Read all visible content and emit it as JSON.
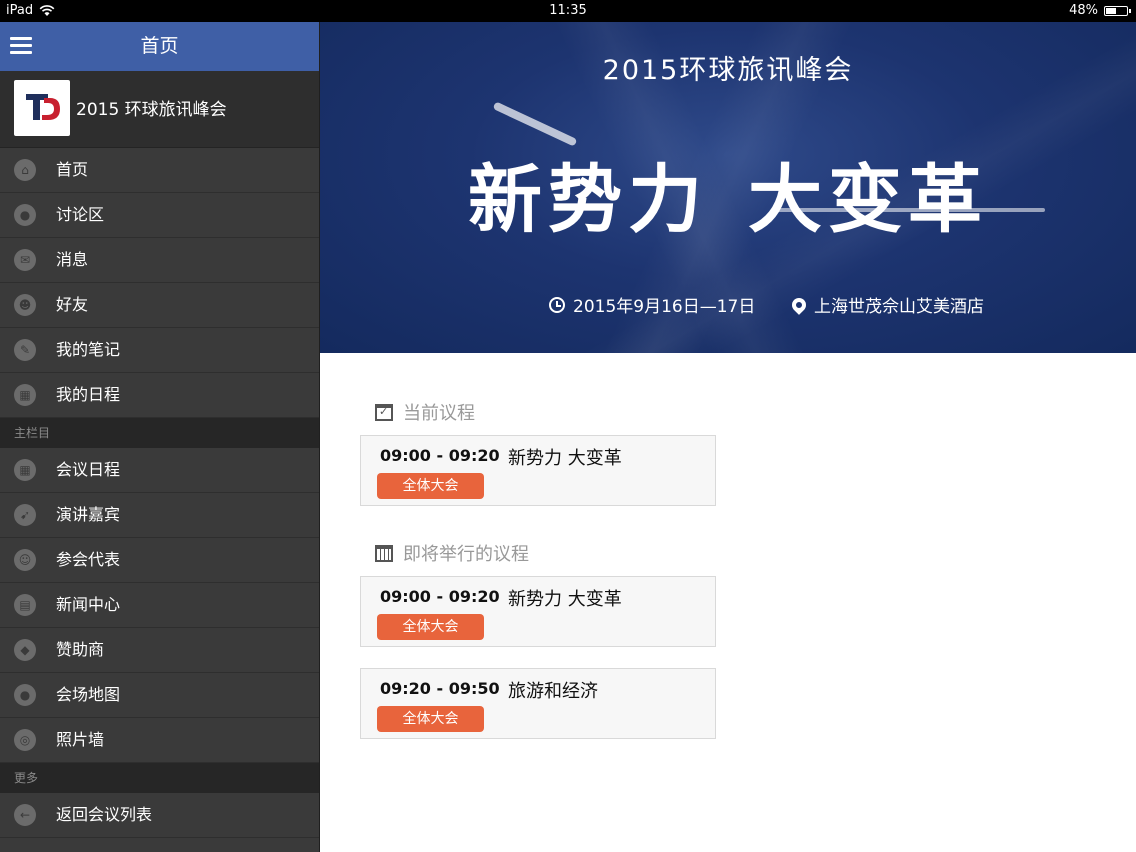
{
  "status_bar": {
    "device": "iPad",
    "time": "11:35",
    "battery": "48%",
    "battery_level": 0.48
  },
  "sidebar": {
    "header_title": "首页",
    "brand_name": "2015 环球旅讯峰会",
    "items": [
      {
        "label": "首页",
        "icon": "home-icon"
      },
      {
        "label": "讨论区",
        "icon": "chat-icon"
      },
      {
        "label": "消息",
        "icon": "mail-icon"
      },
      {
        "label": "好友",
        "icon": "friends-icon"
      },
      {
        "label": "我的笔记",
        "icon": "pencil-icon"
      },
      {
        "label": "我的日程",
        "icon": "schedule-icon"
      }
    ],
    "section_main": "主栏目",
    "main_items": [
      {
        "label": "会议日程",
        "icon": "calendar-icon"
      },
      {
        "label": "演讲嘉宾",
        "icon": "microphone-icon"
      },
      {
        "label": "参会代表",
        "icon": "person-icon"
      },
      {
        "label": "新闻中心",
        "icon": "news-icon"
      },
      {
        "label": "赞助商",
        "icon": "diamond-icon"
      },
      {
        "label": "会场地图",
        "icon": "map-pin-icon"
      },
      {
        "label": "照片墙",
        "icon": "camera-icon"
      }
    ],
    "section_more": "更多",
    "more_items": [
      {
        "label": "返回会议列表",
        "icon": "back-arrow-icon"
      }
    ]
  },
  "banner": {
    "title": "2015环球旅讯峰会",
    "slogan_left": "新势力",
    "slogan_right": "大变革",
    "date": "2015年9月16日—17日",
    "location": "上海世茂佘山艾美酒店"
  },
  "agenda": {
    "current_title": "当前议程",
    "upcoming_title": "即将举行的议程",
    "current": [
      {
        "time": "09:00 - 09:20",
        "name": "新势力 大变革",
        "tag": "全体大会"
      }
    ],
    "upcoming": [
      {
        "time": "09:00 - 09:20",
        "name": "新势力 大变革",
        "tag": "全体大会"
      },
      {
        "time": "09:20 - 09:50",
        "name": "旅游和经济",
        "tag": "全体大会"
      }
    ]
  },
  "colors": {
    "header_blue": "#3f5fa6",
    "sidebar_bg": "#3a3a3a",
    "tag_orange": "#e8643c",
    "banner_blue": "#1d3470"
  }
}
